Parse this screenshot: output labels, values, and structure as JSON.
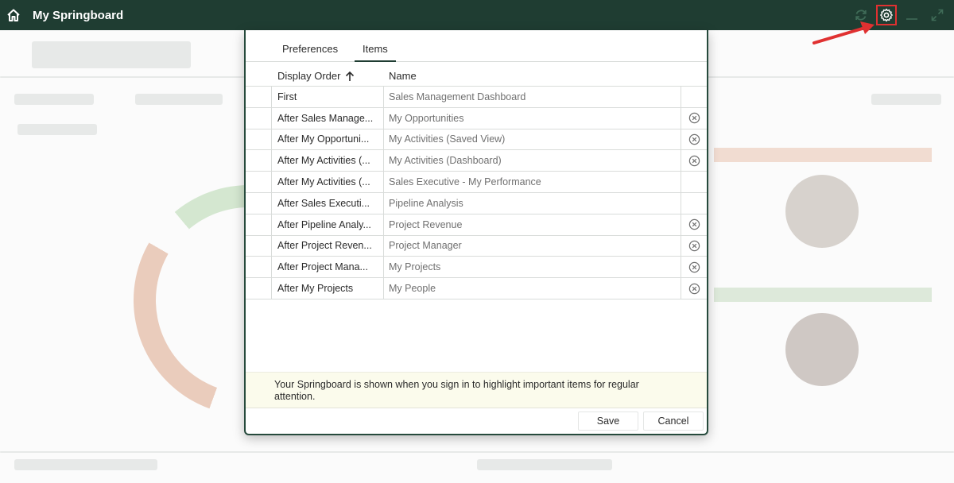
{
  "app": {
    "title": "My Springboard"
  },
  "topbar": {
    "home_icon": "home-icon",
    "refresh_icon": "refresh-icon",
    "settings_icon": "gear-icon",
    "minimize_icon": "minimize-icon",
    "maximize_icon": "maximize-icon",
    "bar_color": "#1f3d32",
    "highlight_color": "#e03131"
  },
  "dialog": {
    "tabs": [
      {
        "label": "Preferences",
        "active": false
      },
      {
        "label": "Items",
        "active": true
      }
    ],
    "columns": {
      "order": "Display Order",
      "name": "Name",
      "sort_icon": "arrow-up-icon"
    },
    "rows": [
      {
        "order": "First",
        "name": "Sales Management Dashboard",
        "removable": false
      },
      {
        "order": "After Sales Manage...",
        "name": "My Opportunities",
        "removable": true
      },
      {
        "order": "After My Opportuni...",
        "name": "My Activities (Saved View)",
        "removable": true
      },
      {
        "order": "After My Activities (...",
        "name": "My Activities (Dashboard)",
        "removable": true
      },
      {
        "order": "After My Activities (...",
        "name": "Sales Executive - My Performance",
        "removable": false
      },
      {
        "order": "After Sales Executi...",
        "name": "Pipeline Analysis",
        "removable": false
      },
      {
        "order": "After Pipeline Analy...",
        "name": "Project Revenue",
        "removable": true
      },
      {
        "order": "After Project Reven...",
        "name": "Project Manager",
        "removable": true
      },
      {
        "order": "After Project Mana...",
        "name": "My Projects",
        "removable": true
      },
      {
        "order": "After My Projects",
        "name": "My People",
        "removable": true
      }
    ],
    "info_text": "Your Springboard is shown when you sign in to highlight important items for regular attention.",
    "buttons": {
      "save": "Save",
      "cancel": "Cancel"
    }
  }
}
